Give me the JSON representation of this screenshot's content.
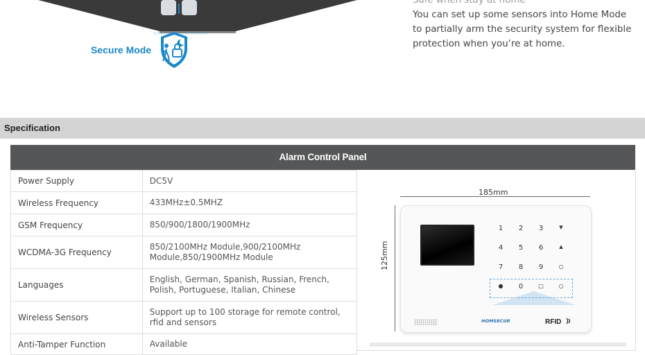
{
  "hero": {
    "mode_label": "Secure Mode",
    "desc_top_partial": "Safe when stay at home",
    "description": [
      "You can set up some sensors into Home Mode",
      "to partially arm the security system for flexible",
      "protection when you’re at home."
    ]
  },
  "spec_section": {
    "title": "Specification"
  },
  "panel": {
    "title": "Alarm Control Panel",
    "rows": [
      {
        "key": "Power Supply",
        "value": "DC5V"
      },
      {
        "key": "Wireless Frequency",
        "value": "433MHz±0.5MHZ"
      },
      {
        "key": "GSM Frequency",
        "value": "850/900/1800/1900MHz"
      },
      {
        "key": "WCDMA-3G Frequency",
        "value": "850/2100MHz Module,900/2100MHz Module,850/1900MHz Module"
      },
      {
        "key": "Languages",
        "value": "English, German, Spanish, Russian, French, Polish, Portuguese, Italian, Chinese"
      },
      {
        "key": "Wireless Sensors",
        "value": "Support up to 100 storage for remote control, rfid and sensors"
      },
      {
        "key": "Anti-Tamper Function",
        "value": "Available"
      }
    ]
  },
  "device": {
    "width_label": "185mm",
    "height_label": "125mm",
    "keys": [
      "1",
      "2",
      "3",
      "▼",
      "4",
      "5",
      "6",
      "▲",
      "7",
      "8",
      "9",
      "○"
    ],
    "bottom_keys": [
      "●",
      "0",
      "□",
      "○"
    ],
    "brand": "HOMSECUR",
    "rfid": "RFID"
  },
  "colors": {
    "accent": "#1b87c9",
    "header_bg": "#555657",
    "spec_bar": "#d4d4d4"
  }
}
